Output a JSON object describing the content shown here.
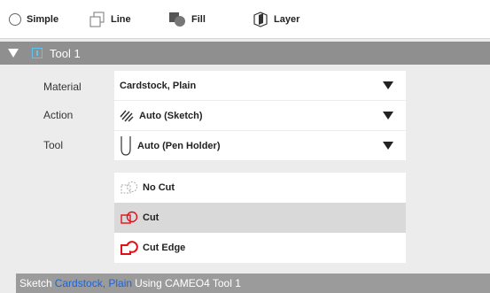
{
  "tabs": [
    {
      "label": "Simple",
      "icon": "radio-icon"
    },
    {
      "label": "Line",
      "icon": "line-style-icon"
    },
    {
      "label": "Fill",
      "icon": "fill-icon"
    },
    {
      "label": "Layer",
      "icon": "layer-icon"
    }
  ],
  "tool_header": {
    "title": "Tool 1",
    "icon": "tool-indicator-icon"
  },
  "fields": {
    "material": {
      "label": "Material",
      "value": "Cardstock, Plain"
    },
    "action": {
      "label": "Action",
      "value": "Auto (Sketch)",
      "icon": "sketch-icon"
    },
    "tool": {
      "label": "Tool",
      "value": "Auto (Pen Holder)",
      "icon": "pen-holder-icon"
    }
  },
  "cut_options": [
    {
      "label": "No Cut",
      "icon": "no-cut-icon",
      "selected": false
    },
    {
      "label": "Cut",
      "icon": "cut-icon",
      "selected": true
    },
    {
      "label": "Cut Edge",
      "icon": "cut-edge-icon",
      "selected": false
    }
  ],
  "status": {
    "prefix": "Sketch",
    "material": "Cardstock, Plain",
    "suffix": "Using CAMEO4 Tool 1"
  },
  "colors": {
    "accent": "#1e64d6",
    "cut_red": "#e0101b",
    "header_gray": "#8f8f8f"
  }
}
